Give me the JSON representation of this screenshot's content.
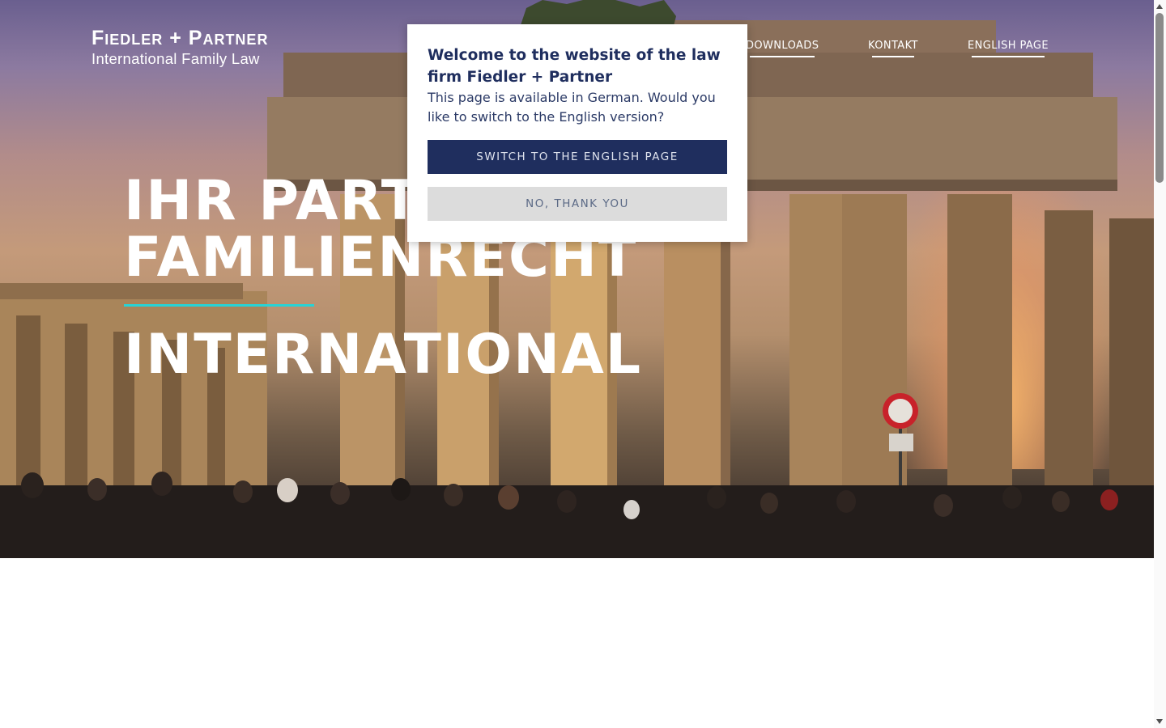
{
  "brand": {
    "name": "Fiedler + Partner",
    "tagline": "International Family Law"
  },
  "nav": {
    "items": [
      "DOWNLOADS",
      "KONTAKT",
      "ENGLISH PAGE"
    ]
  },
  "hero": {
    "line1": "IHR PARTNER IM",
    "line2": "FAMILIENRECHT",
    "line3": "INTERNATIONAL",
    "accent_color": "#27d3d6"
  },
  "modal": {
    "title": "Welcome to the website of the law firm Fiedler + Partner",
    "body": "This page is available in German. Would you like to switch to the English version?",
    "primary_button": "SWITCH TO THE ENGLISH PAGE",
    "secondary_button": "NO, THANK YOU",
    "primary_color": "#1f2e5e"
  }
}
